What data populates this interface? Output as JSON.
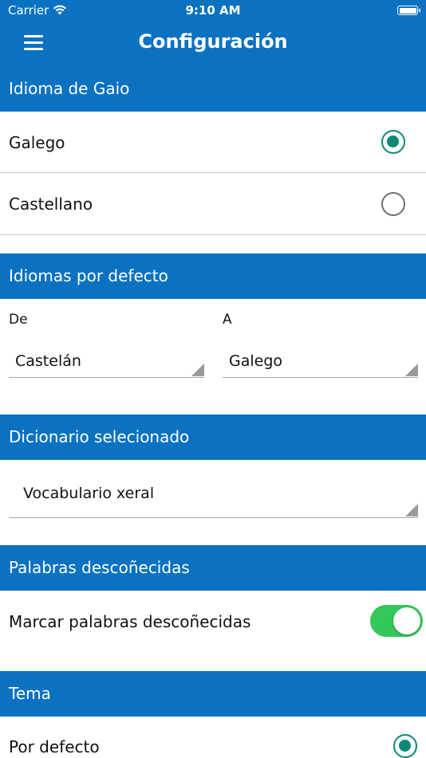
{
  "status_bar": {
    "carrier": "Carrier",
    "time": "9:10 AM"
  },
  "nav": {
    "title": "Configuración",
    "menu_icon": "hamburger-icon"
  },
  "gaio_language": {
    "header": "Idioma de Gaio",
    "options": [
      {
        "label": "Galego",
        "selected": true
      },
      {
        "label": "Castellano",
        "selected": false
      }
    ]
  },
  "default_languages": {
    "header": "Idiomas por defecto",
    "from_label": "De",
    "from_value": "Castelán",
    "to_label": "A",
    "to_value": "Galego"
  },
  "dictionary": {
    "header": "Dicionario selecionado",
    "value": "Vocabulario xeral"
  },
  "unknown_words": {
    "header": "Palabras descoñecidas",
    "toggle_label": "Marcar palabras descoñecidas",
    "toggle_on": true
  },
  "theme": {
    "header": "Tema",
    "options": [
      {
        "label": "Por defecto",
        "selected": true
      }
    ]
  },
  "colors": {
    "accent_blue": "#0a72c1",
    "radio_green": "#0a8a76",
    "toggle_green": "#34c759"
  }
}
